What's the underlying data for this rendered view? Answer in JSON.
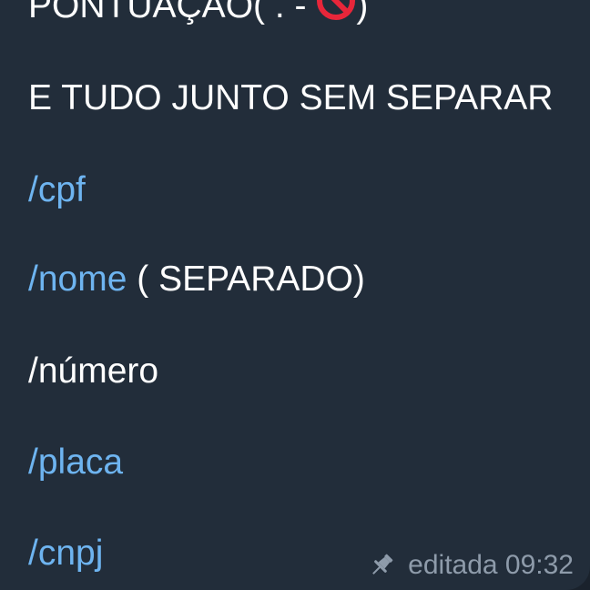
{
  "message": {
    "line0_text": "PONTUAÇÃO( . - ",
    "line0_close": ")",
    "no_entry_icon": "no-entry-sign",
    "line1": "E TUDO JUNTO SEM SEPARAR",
    "cpf_cmd": "/cpf",
    "nome_cmd": "/nome",
    "nome_suffix": " ( SEPARADO)",
    "numero_text": "/número",
    "placa_cmd": "/placa",
    "cnpj_cmd": "/cnpj"
  },
  "meta": {
    "pin_icon": "pushpin",
    "edited_label": "editada 09:32"
  },
  "colors": {
    "bubble": "#222d3a",
    "background": "#1a222c",
    "command_link": "#6eb4f0",
    "meta_text": "#8e9baa",
    "no_entry_red": "#e8263a"
  }
}
